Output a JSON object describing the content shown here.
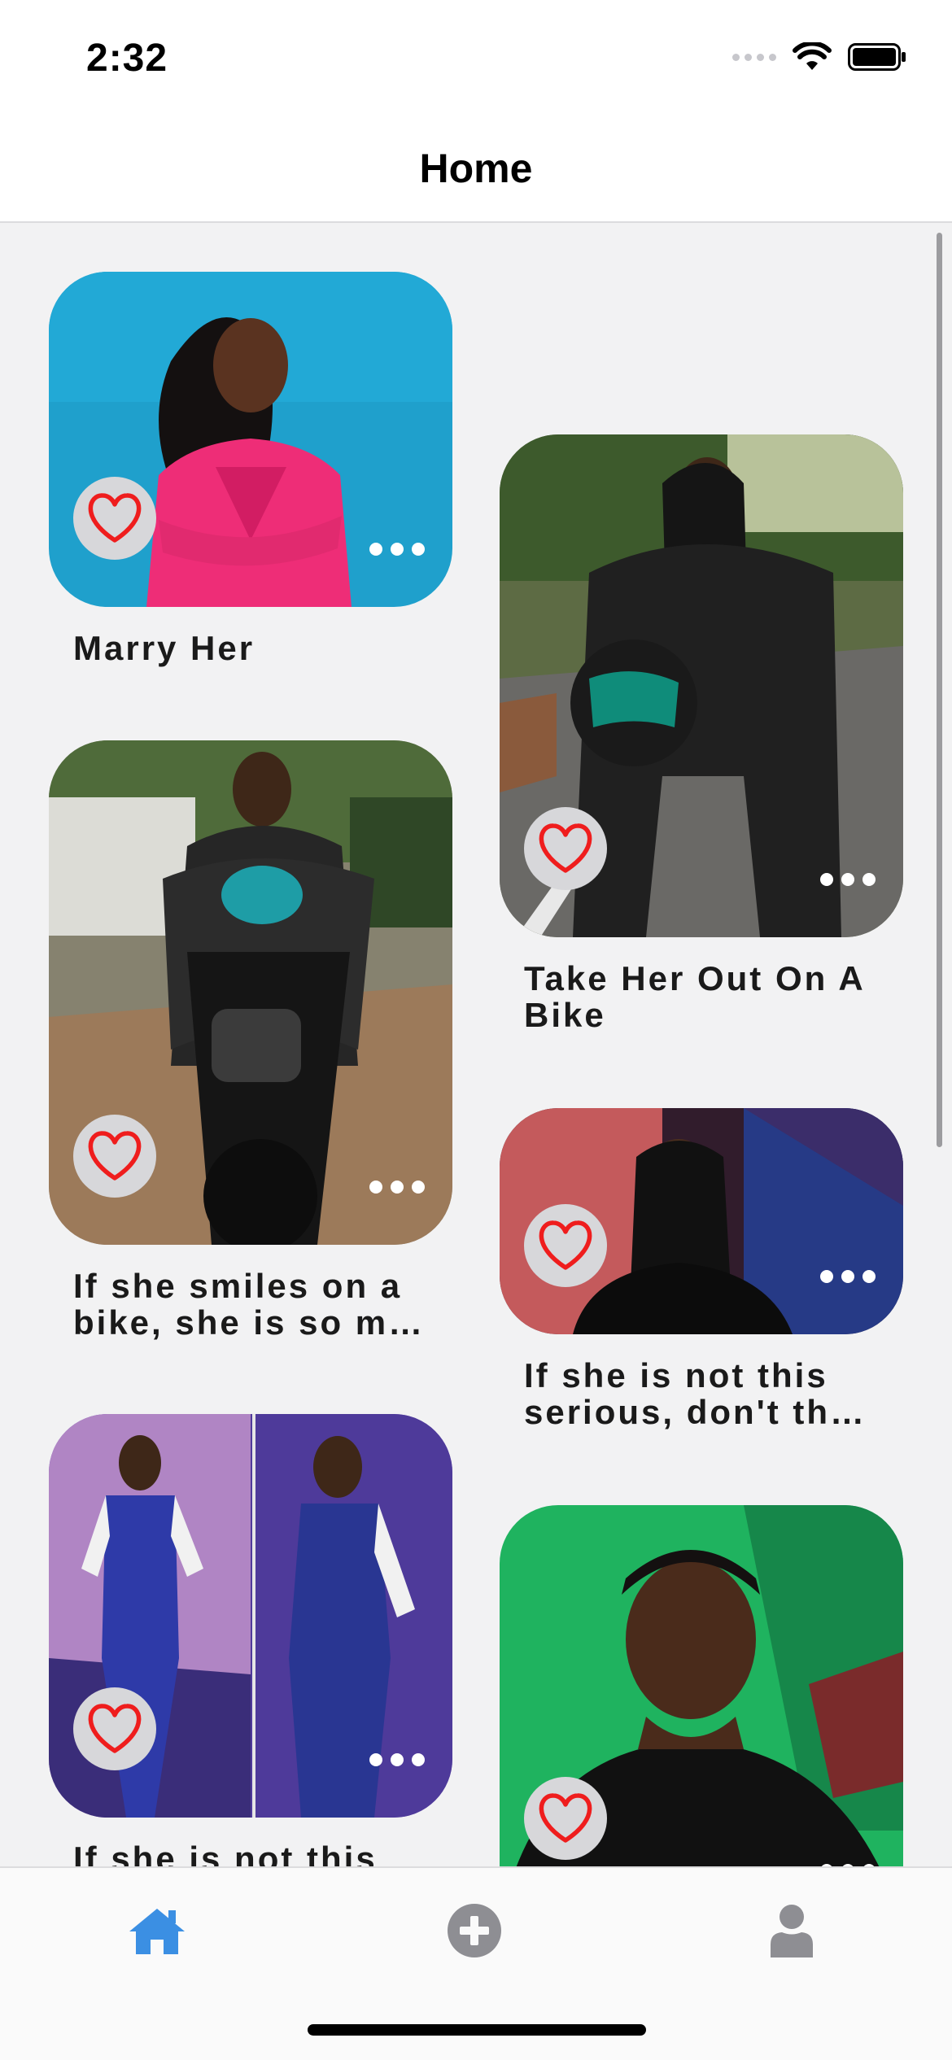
{
  "status": {
    "time": "2:32"
  },
  "nav": {
    "title": "Home"
  },
  "icons": {
    "heart": "heart-outline-icon",
    "more": "ellipsis-icon",
    "home": "home-icon",
    "add": "plus-circle-icon",
    "profile": "person-icon"
  },
  "colors": {
    "heart": "#ef1d1d",
    "tab_active": "#3b8fe3",
    "tab_inactive": "#8e8e93"
  },
  "cards": [
    {
      "title": "Marry Her"
    },
    {
      "title": "Take Her Out On A Bike"
    },
    {
      "title": "If she smiles on a bike, she is so m…"
    },
    {
      "title": "If she is not this serious, don't th…"
    },
    {
      "title": "If she is not this"
    },
    {
      "title": ""
    }
  ],
  "tabs": [
    {
      "name": "home",
      "active": true
    },
    {
      "name": "add",
      "active": false
    },
    {
      "name": "profile",
      "active": false
    }
  ]
}
